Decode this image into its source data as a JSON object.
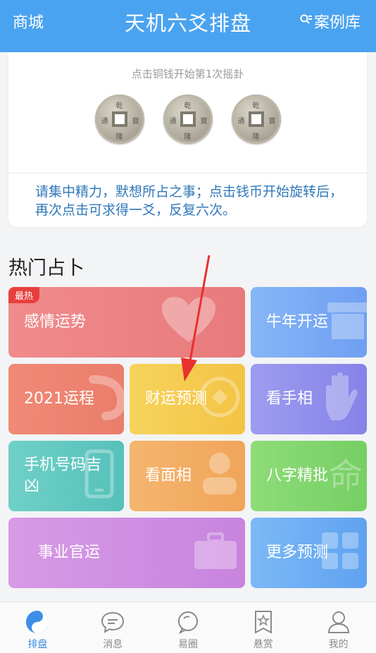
{
  "header": {
    "left_label": "商城",
    "title": "天机六爻排盘",
    "right_label": "案例库",
    "right_icon": "search-list-icon",
    "bg_color": "#4aa3f0"
  },
  "divination_card": {
    "hint": "点击铜钱开始第1次摇卦",
    "coins": [
      {
        "icon": "copper-coin-icon"
      },
      {
        "icon": "copper-coin-icon"
      },
      {
        "icon": "copper-coin-icon"
      }
    ],
    "instruction": "请集中精力，默想所占之事；点击钱币开始旋转后，再次点击可求得一爻，反复六次。"
  },
  "section": {
    "title": "热门占卜"
  },
  "tiles": {
    "emotion": {
      "label": "感情运势",
      "badge": "最热",
      "icon": "heart-icon"
    },
    "ox_year": {
      "label": "牛年开运",
      "icon": "shop-icon"
    },
    "year_2021": {
      "label": "2021运程",
      "icon": "swirl-icon"
    },
    "wealth": {
      "label": "财运预测",
      "icon": "coin-icon"
    },
    "palm": {
      "label": "看手相",
      "icon": "hand-icon"
    },
    "phone": {
      "label": "手机号码吉凶",
      "icon": "phone-icon"
    },
    "face": {
      "label": "看面相",
      "icon": "person-icon"
    },
    "bazi": {
      "label": "八字精批",
      "icon": "fate-character-icon"
    },
    "career": {
      "label": "事业官运",
      "icon": "briefcase-icon"
    },
    "more": {
      "label": "更多预测",
      "icon": "grid-icon"
    }
  },
  "tabbar": {
    "items": [
      {
        "label": "排盘",
        "icon": "yin-yang-icon",
        "active": true
      },
      {
        "label": "消息",
        "icon": "chat-bubble-icon",
        "active": false
      },
      {
        "label": "易圈",
        "icon": "circle-bubble-icon",
        "active": false
      },
      {
        "label": "悬赏",
        "icon": "star-bookmark-icon",
        "active": false
      },
      {
        "label": "我的",
        "icon": "user-icon",
        "active": false
      }
    ],
    "active_color": "#3d8ee6"
  },
  "annotation": {
    "arrow_color": "#e8312c"
  }
}
